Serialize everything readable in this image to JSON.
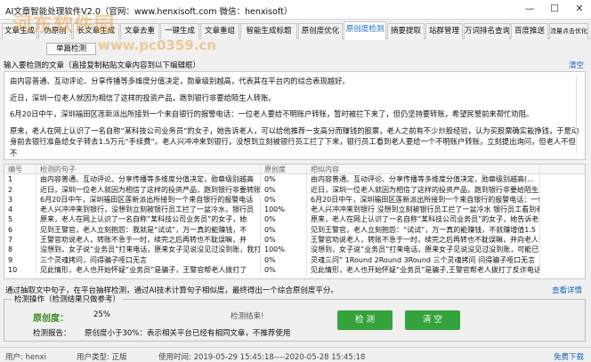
{
  "window": {
    "title": "AI文章智能处理软件V2.0（官网：www.henxisoft.com    微信：henxisoft）",
    "controls": [
      "—",
      "☐",
      "✕"
    ]
  },
  "watermark": {
    "brand": "河东软件园",
    "url": "www.pc0359.cn"
  },
  "tabs": [
    {
      "label": "文章生成",
      "active": false
    },
    {
      "label": "伪原创",
      "active": false
    },
    {
      "label": "长文章生成",
      "active": false
    },
    {
      "label": "文章去重",
      "active": false
    },
    {
      "label": "一键生成",
      "active": false
    },
    {
      "label": "文章重组",
      "active": false
    },
    {
      "label": "智能生成标题",
      "active": false
    },
    {
      "label": "原创度优化",
      "active": false
    },
    {
      "label": "原创度检测",
      "active": true
    },
    {
      "label": "摘要提取",
      "active": false
    },
    {
      "label": "站群管理",
      "active": false
    },
    {
      "label": "万词排名查询",
      "active": false
    },
    {
      "label": "百度推送",
      "active": false
    },
    {
      "label": "流量点击优化",
      "active": false
    },
    {
      "label": "其他工具",
      "active": false
    }
  ],
  "sub_toolbar": {
    "button_label": "单篇检测"
  },
  "input_section": {
    "label": "输入要检测的文章（直接复制粘贴文章内容到以下编辑框）",
    "clear_link": "清空"
  },
  "article": {
    "paragraphs": [
      "由内容普通、互动评论、分享传播等多维度分值决定，勋章级别越高，代表其在平台内的综合表现越好。",
      "近日，深圳一位老人就因为相信了这样的投资产品，跑到银行非要给陌生人转账。",
      "6月20日中午，深圳福田区莲新派出所接到一个来自银行的报警电话：一位老人要给不明账户转账，暂时被拦下来了，但仍坚持要转账，希望民警前来帮忙劝阻。",
      "原来，老人在网上认识了一名自称“某科技公司业务员”的女子，她告诉老人，可以给他推荐一支高分而赚钱的股票，老人之前有不少炒股经验，认为买股票确实能挣钱，于是动身前去银行准备给女子转去1.5万元“手续费”。老人兴冲冲来到银行，没想到立刻被银行员工拦了下来，银行员工看到老人要给一个不明账户转账，立刻提出询问，但老人不但不"
    ]
  },
  "table": {
    "headers": [
      "编号",
      "检测的句子",
      "原创度",
      "相似内容",
      ""
    ],
    "rows": [
      [
        "1",
        "由内容普通、互动评论、分享传播等多维度分值决定，勋章级别越高",
        "0%",
        "由内容普通、互动评论、分享传播等多维度分值决定，勋章级别越高(...",
        ""
      ],
      [
        "2",
        "近日，深圳一位老人就因为相信了这样的投资产品，跑到银行非要转账",
        "0%",
        "近日，深圳一位老人就因为相信了这样的投资产品，跑到银行非要给陌生人转",
        ""
      ],
      [
        "3",
        "6月20日中午，深圳福田区莲新派出所接到一个来自银行的报警电话",
        "0%",
        "6月20日中午，深圳福田区莲新派出所接到一个来自银行的报警电话：一位老",
        ""
      ],
      [
        "4",
        "老人兴冲冲来到银行，没想到立刻被银行员工拦了一盆冷水，银行员",
        "100%",
        "老人兴冲冲来到银行 没想到立刻被银行员工拦了一盆冷水 银行员工看到老人",
        ""
      ],
      [
        "5",
        "原来，老人在网上认识了一名自称“某科技公司业务员”的女子，她",
        "0%",
        "原来，老人在网上认识了一名自称“某科技公司业务员”的女子，她告诉老人",
        ""
      ],
      [
        "6",
        "见到王警官，老人立刻抱怨：我就是“试试”，万一真的能赚钱，不",
        "0%",
        "见到王警官，老人立刻抱怨：“试试”，万一真的能赚钱，不就赚增值1.5",
        ""
      ],
      [
        "7",
        "王警官劝说老人，转账不急于一时，续完之后再转也不耽误嘛，并",
        "0%",
        "王警官劝说老人，转账不急于一时，续完之后再转也不耽误嘛，并向老人讲解",
        ""
      ],
      [
        "8",
        "没想到，女子说“业务员”打来电话，原来女子见说没见过没到账，我打",
        "100%",
        "没想到，女子说“业务员”打来电话，原来女子见说没见过没到账，可能已",
        ""
      ],
      [
        "9",
        "三个灵魂拷问，问得骗子哑口无言",
        "0%",
        "灵魂三问” 1Round 2Round 3Round 三个灵魂拷问 问得骗子哑口无言",
        ""
      ],
      [
        "10",
        "见此情形，老人也开始怀疑“业务员”是骗子，王警官帮老人拨打了",
        "0%",
        "见此情形，老人也开始怀疑“业务员”是骗子,王警官帮老人拨打了反诈电话",
        ""
      ]
    ]
  },
  "hint": {
    "text": "通过抽取文中句子，在平台抽样检测，通过AI技术计算句子相似度，最终得出一个综合原创度平分。",
    "details_link": "查看详情"
  },
  "detect_group": {
    "title": "检测操作（检测结果只做参考）",
    "originality_label": "原创度：",
    "originality_value": "25%",
    "status_text": "检测结束!",
    "report_label": "检测报告：",
    "report_text": "原创度小于30%：表示相关平台已经有相同文章，不推荐使用",
    "detect_button": "检 测",
    "clear_button": "清 空"
  },
  "statusbar": {
    "user": "用户: henxi",
    "user_type": "用户类型: 正版",
    "expiry": "使用时间: 2019-05-29 15:45:18----2020-05-28 15:45:18",
    "free_link": "免费下载"
  }
}
